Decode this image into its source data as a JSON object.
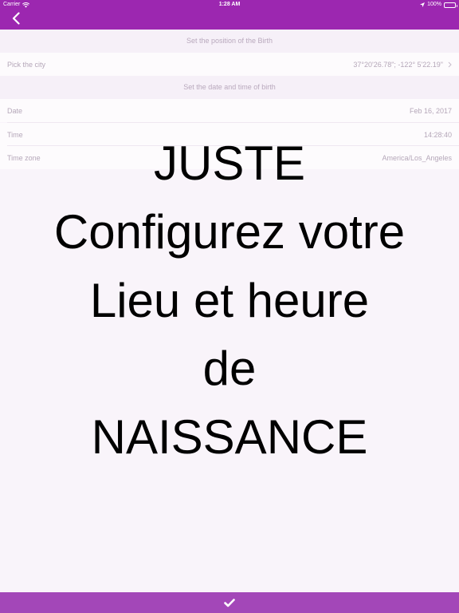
{
  "status": {
    "carrier": "Carrier",
    "time": "1:28 AM",
    "battery": "100%"
  },
  "sections": {
    "position_header": "Set the position of the Birth",
    "datetime_header": "Set the date and time of birth"
  },
  "rows": {
    "city": {
      "label": "Pick the city",
      "value": "37°20'26.78\"; -122° 5'22.19\""
    },
    "date": {
      "label": "Date",
      "value": "Feb 16, 2017"
    },
    "time": {
      "label": "Time",
      "value": "14:28:40"
    },
    "timezone": {
      "label": "Time zone",
      "value": "America/Los_Angeles"
    }
  },
  "overlay": {
    "lines": [
      "JUSTE",
      "Configurez votre",
      "Lieu et heure",
      "de",
      "NAISSANCE"
    ]
  },
  "icons": {
    "back": "chevron-left-icon",
    "disclosure": "chevron-right-icon",
    "confirm": "checkmark-icon"
  },
  "colors": {
    "bar": "#9c27b0",
    "bottom_bar": "#a347b8",
    "background": "#f9f4fa"
  }
}
